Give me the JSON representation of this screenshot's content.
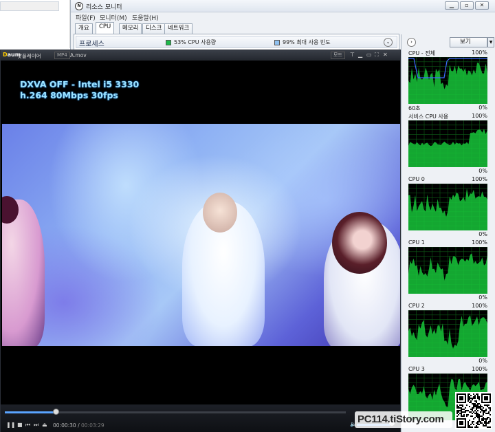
{
  "resource_monitor": {
    "title": "리소스 모니터",
    "app_icon": "resmon-icon",
    "window_buttons": [
      "minimize-icon",
      "restore-icon",
      "close-icon"
    ],
    "menu": [
      "파일(F)",
      "모니터(M)",
      "도움말(H)"
    ],
    "tabs": [
      "개요",
      "CPU",
      "메모리",
      "디스크",
      "네트워크"
    ],
    "active_tab": "CPU",
    "processes_section": {
      "title": "프로세스",
      "cpu_usage_label": "53% CPU 사용량",
      "cpu_usage_color": "#1db94a",
      "max_freq_label": "99% 최대 사용 빈도",
      "max_freq_color": "#8fc1f0"
    },
    "graph_panel": {
      "view_label": "보기",
      "graphs": [
        {
          "title": "CPU - 전체",
          "top_pct": "100%",
          "bottom_left": "60초",
          "bottom_right": "0%"
        },
        {
          "title": "서비스 CPU 사용",
          "top_pct": "100%",
          "bottom_left": "",
          "bottom_right": "0%"
        },
        {
          "title": "CPU 0",
          "top_pct": "100%",
          "bottom_left": "",
          "bottom_right": "0%"
        },
        {
          "title": "CPU 1",
          "top_pct": "100%",
          "bottom_left": "",
          "bottom_right": "0%"
        },
        {
          "title": "CPU 2",
          "top_pct": "100%",
          "bottom_left": "",
          "bottom_right": "0%"
        },
        {
          "title": "CPU 3",
          "top_pct": "100%",
          "bottom_left": "",
          "bottom_right": ""
        }
      ]
    }
  },
  "player": {
    "logo": "Daum",
    "name": "팟플레이어",
    "format_badge": "MP4",
    "file_name": "A.mov",
    "mode_button": "모드",
    "overlay_line1": "DXVA OFF - Intel i5 3330",
    "overlay_line2": "h.264 80Mbps 30fps",
    "time_current": "00:00:30",
    "time_separator": "/",
    "time_total": "00:03:29",
    "progress_fraction": 0.15,
    "volume_fraction": 0.95
  },
  "watermark": {
    "text": "PC114.tiStory.com"
  }
}
